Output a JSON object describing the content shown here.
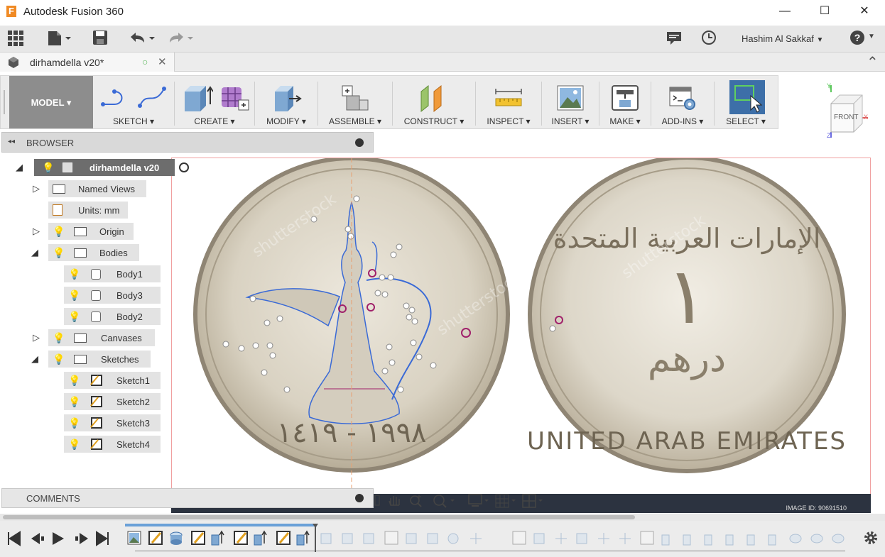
{
  "window": {
    "app_logo": "F",
    "title": "Autodesk Fusion 360",
    "minimize": "—",
    "maximize": "☐",
    "close": "✕"
  },
  "appbar": {
    "user_name": "Hashim Al Sakkaf",
    "user_caret": "▼",
    "help_caret": "▼"
  },
  "tab": {
    "name": "dirhamdella v20*",
    "save_status": "○",
    "close": "✕",
    "collapse": "⌃"
  },
  "ribbon": {
    "workspace": "MODEL ▾",
    "groups": [
      {
        "label": "SKETCH ▾"
      },
      {
        "label": "CREATE ▾"
      },
      {
        "label": "MODIFY ▾"
      },
      {
        "label": "ASSEMBLE ▾"
      },
      {
        "label": "CONSTRUCT ▾"
      },
      {
        "label": "INSPECT ▾"
      },
      {
        "label": "INSERT ▾"
      },
      {
        "label": "MAKE ▾"
      },
      {
        "label": "ADD-INS ▾"
      },
      {
        "label": "SELECT ▾"
      }
    ]
  },
  "viewcube": {
    "face": "FRONT",
    "x_axis": "X",
    "y_axis": "Y",
    "z_axis": "Z"
  },
  "browser": {
    "header": "BROWSER",
    "collapse": "◂◂",
    "tree": [
      {
        "label": "dirhamdella v20"
      },
      {
        "label": "Named Views"
      },
      {
        "label": "Units: mm"
      },
      {
        "label": "Origin"
      },
      {
        "label": "Bodies"
      },
      {
        "label": "Body1"
      },
      {
        "label": "Body3"
      },
      {
        "label": "Body2"
      },
      {
        "label": "Canvases"
      },
      {
        "label": "Sketches"
      },
      {
        "label": "Sketch1"
      },
      {
        "label": "Sketch2"
      },
      {
        "label": "Sketch3"
      },
      {
        "label": "Sketch4"
      }
    ]
  },
  "canvas": {
    "coin_left_year": "١٩٩٨ - ١٤١٩",
    "coin_right_arabic_top": "الإمارات العربية المتحدة",
    "coin_right_numeral": "١",
    "coin_right_value": "درهم",
    "coin_right_english": "UNITED ARAB EMIRATES",
    "image_id": "IMAGE ID: 90691510",
    "watermark": "shutterstock"
  },
  "comments": {
    "label": "COMMENTS"
  },
  "colors": {
    "accent_select": "#3d6fa8",
    "ribbon_bg": "#ececec",
    "model_bg": "#8d8d8d",
    "sketch_blue": "#3a6ad6",
    "constraint_magenta": "#a0206a"
  }
}
